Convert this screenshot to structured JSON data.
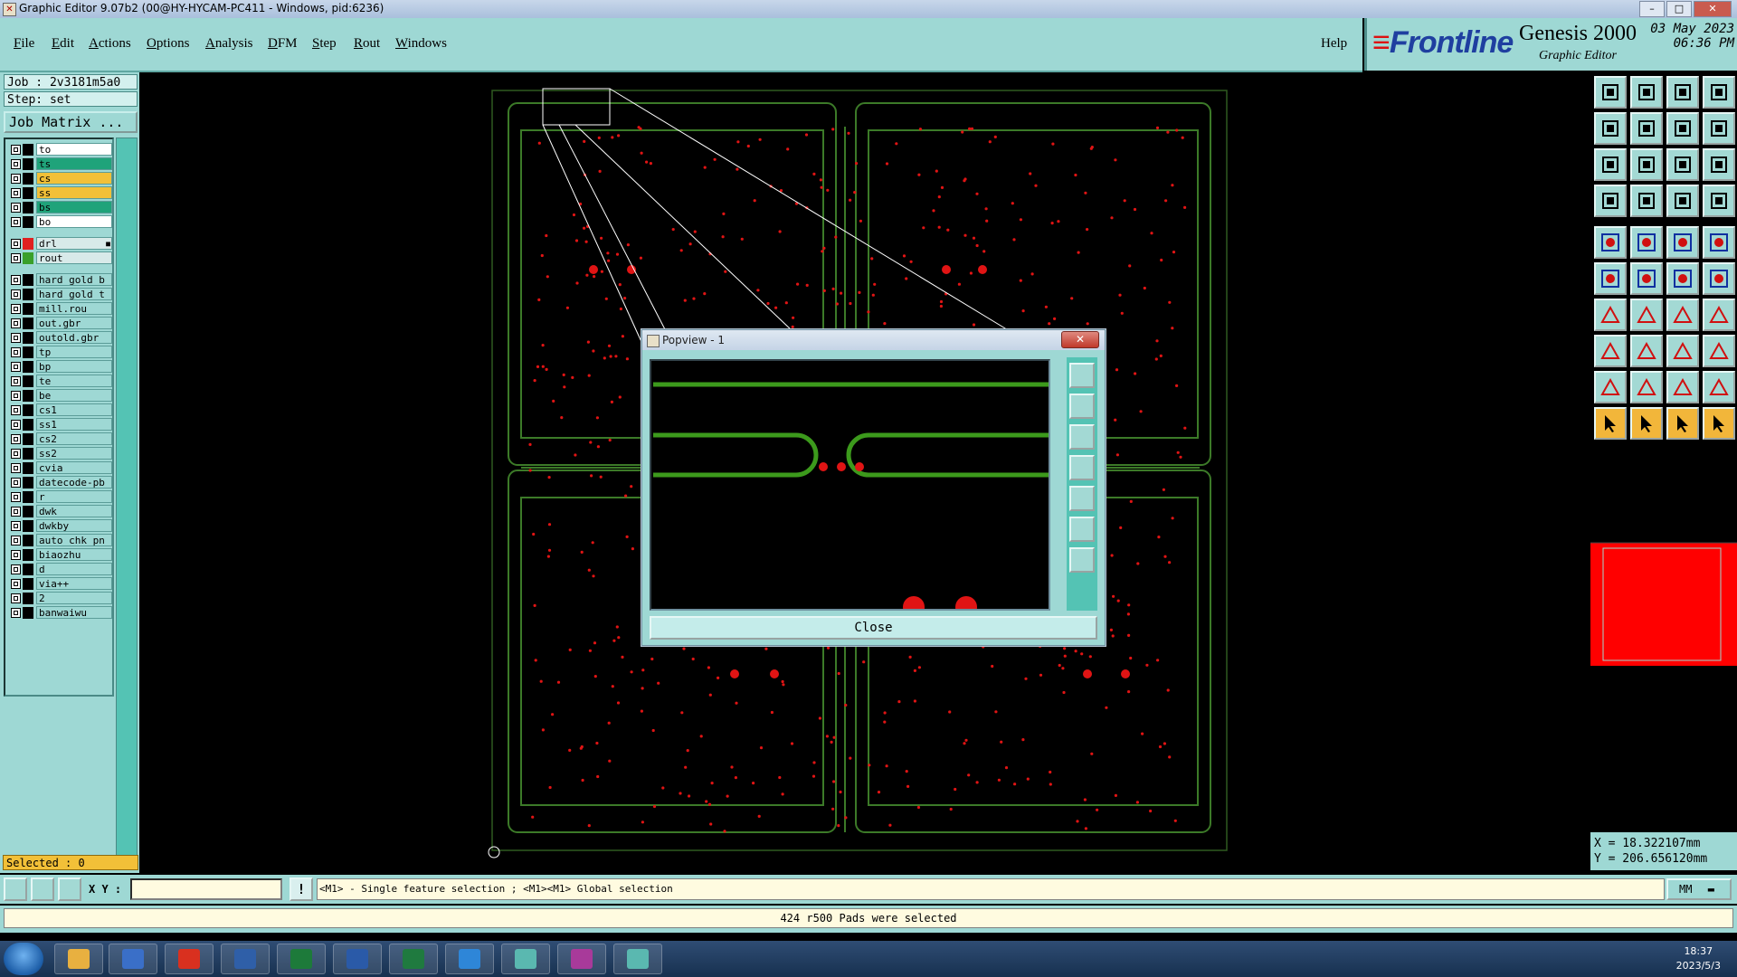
{
  "window": {
    "title": "Graphic Editor 9.07b2 (00@HY-HYCAM-PC411 - Windows, pid:6236)",
    "buttons": [
      "–",
      "□",
      "✕"
    ]
  },
  "menu": {
    "items": [
      "File",
      "Edit",
      "Actions",
      "Options",
      "Analysis",
      "DFM",
      "Step",
      "Rout",
      "Windows"
    ],
    "help": "Help"
  },
  "brand": {
    "logo": "Frontline",
    "product": "Genesis 2000",
    "subtitle": "Graphic Editor",
    "date": "03 May 2023",
    "time": "06:36 PM"
  },
  "job": {
    "job_line": "Job : 2v3181m5a0",
    "step_line": "Step: set",
    "job_matrix": "Job Matrix ..."
  },
  "layers": [
    {
      "name": "to",
      "color": "#ffffff"
    },
    {
      "name": "ts",
      "color": "#1fa37a"
    },
    {
      "name": "cs",
      "color": "#f2c038"
    },
    {
      "name": "ss",
      "color": "#f2c038"
    },
    {
      "name": "bs",
      "color": "#1fa37a"
    },
    {
      "name": "bo",
      "color": "#ffffff"
    },
    {
      "name": "drl",
      "color": "#d8eae9",
      "swatch": "#e02020",
      "flag": "■"
    },
    {
      "name": "rout",
      "color": "#d8eae9",
      "swatch": "#3aa02a"
    },
    {
      "name": "hard_gold_b",
      "color": "#9ed8d4"
    },
    {
      "name": "hard_gold_t",
      "color": "#9ed8d4"
    },
    {
      "name": "mill.rou",
      "color": "#9ed8d4"
    },
    {
      "name": "out.gbr",
      "color": "#9ed8d4"
    },
    {
      "name": "outold.gbr",
      "color": "#9ed8d4"
    },
    {
      "name": "tp",
      "color": "#9ed8d4"
    },
    {
      "name": "bp",
      "color": "#9ed8d4"
    },
    {
      "name": "te",
      "color": "#9ed8d4"
    },
    {
      "name": "be",
      "color": "#9ed8d4"
    },
    {
      "name": "cs1",
      "color": "#9ed8d4"
    },
    {
      "name": "ss1",
      "color": "#9ed8d4"
    },
    {
      "name": "cs2",
      "color": "#9ed8d4"
    },
    {
      "name": "ss2",
      "color": "#9ed8d4"
    },
    {
      "name": "cvia",
      "color": "#9ed8d4"
    },
    {
      "name": "datecode-pb",
      "color": "#9ed8d4"
    },
    {
      "name": "r",
      "color": "#9ed8d4"
    },
    {
      "name": "dwk",
      "color": "#9ed8d4"
    },
    {
      "name": "dwkby",
      "color": "#9ed8d4"
    },
    {
      "name": "auto_chk_pn",
      "color": "#9ed8d4"
    },
    {
      "name": "biaozhu",
      "color": "#9ed8d4"
    },
    {
      "name": "d",
      "color": "#9ed8d4"
    },
    {
      "name": "via++",
      "color": "#9ed8d4"
    },
    {
      "name": "2",
      "color": "#9ed8d4"
    },
    {
      "name": "banwaiwu",
      "color": "#9ed8d4"
    }
  ],
  "selected": "Selected : 0",
  "coords": {
    "x": "X = 18.322107mm",
    "y": "Y = 206.656120mm"
  },
  "status": {
    "xy_label": "X Y :",
    "xy_value": "",
    "bang": "!",
    "prompt": "<M1> - Single feature selection ; <M1><M1> Global selection",
    "units": "MM",
    "message": "424 r500 Pads were selected"
  },
  "popview": {
    "title": "Popview - 1",
    "close_label": "Close"
  },
  "taskbar": {
    "time": "18:37",
    "date": "2023/5/3"
  },
  "colors": {
    "panel": "#9ed8d4",
    "board_outline": "#3c7a28",
    "pad": "#e01414",
    "highlight": "#ff0000"
  }
}
